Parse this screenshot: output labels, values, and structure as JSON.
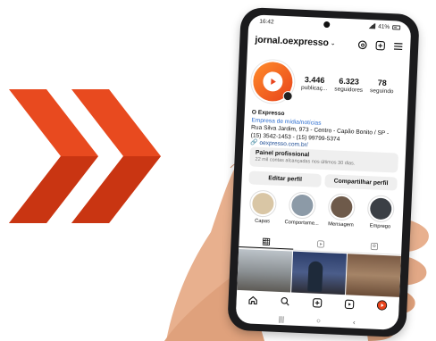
{
  "status": {
    "time": "16:42",
    "battery": "41%"
  },
  "profile": {
    "username": "jornal.oexpresso",
    "stats": [
      {
        "value": "3.446",
        "label": "publicaç..."
      },
      {
        "value": "6.323",
        "label": "seguidores"
      },
      {
        "value": "78",
        "label": "seguindo"
      }
    ],
    "name": "O Expresso",
    "category": "Empresa de mídia/notícias",
    "address": "Rua Silva Jardim, 973 - Centro - Capão Bonito / SP -",
    "phones": "(15) 3542-1453 -   (15) 99799-5374",
    "link": "oexpresso.com.br/"
  },
  "dashboard": {
    "title": "Painel profissional",
    "subtitle": "22 mil contas alcançadas nos últimos 30 dias."
  },
  "buttons": {
    "edit": "Editar perfil",
    "share": "Compartilhar perfil"
  },
  "highlights": [
    {
      "label": "Capas",
      "color": "#d9c6a5"
    },
    {
      "label": "Comportame...",
      "color": "#8c9aa7"
    },
    {
      "label": "Mensagem",
      "color": "#6e5a4a"
    },
    {
      "label": "Emprego",
      "color": "#3b3f45"
    }
  ],
  "colors": {
    "accent": "#e8431b",
    "chevron": "#e84a1f",
    "link": "#2d6ed0"
  }
}
